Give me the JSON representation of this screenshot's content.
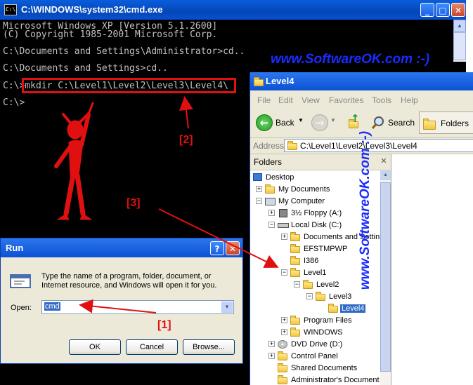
{
  "cmd": {
    "title": "C:\\WINDOWS\\system32\\cmd.exe",
    "lines": [
      "Microsoft Windows XP [Version 5.1.2600]",
      "(C) Copyright 1985-2001 Microsoft Corp.",
      "",
      "C:\\Documents and Settings\\Administrator>cd..",
      "",
      "C:\\Documents and Settings>cd..",
      "",
      "C:\\>mkdir C:\\Level1\\Level2\\Level3\\Level4\\",
      "",
      "C:\\>"
    ]
  },
  "watermark": "www.SoftwareOK.com :-)",
  "watermark_vertical": "www.SoftwareOK.com :-)",
  "explorer": {
    "title": "Level4",
    "menu": [
      "File",
      "Edit",
      "View",
      "Favorites",
      "Tools",
      "Help"
    ],
    "toolbar": {
      "back": "Back",
      "search": "Search",
      "folders": "Folders"
    },
    "address_label": "Address",
    "address_value": "C:\\Level1\\Level2\\Level3\\Level4",
    "pane_title": "Folders",
    "tree": [
      "Desktop",
      "My Documents",
      "My Computer",
      "3½ Floppy (A:)",
      "Local Disk (C:)",
      "Documents and Settin",
      "EFSTMPWP",
      "I386",
      "Level1",
      "Level2",
      "Level3",
      "Level4",
      "Program Files",
      "WINDOWS",
      "DVD Drive (D:)",
      "Control Panel",
      "Shared Documents",
      "Administrator's Document"
    ]
  },
  "run": {
    "title": "Run",
    "description": "Type the name of a program, folder, document, or Internet resource, and Windows will open it for you.",
    "open_label": "Open:",
    "open_value": "cmd",
    "ok": "OK",
    "cancel": "Cancel",
    "browse": "Browse..."
  },
  "annotations": {
    "one": "[1]",
    "two": "[2]",
    "three": "[3]"
  },
  "colors": {
    "annotation": "#e01010",
    "watermark": "#1a2bff",
    "xp_title": "#0b52d4"
  }
}
